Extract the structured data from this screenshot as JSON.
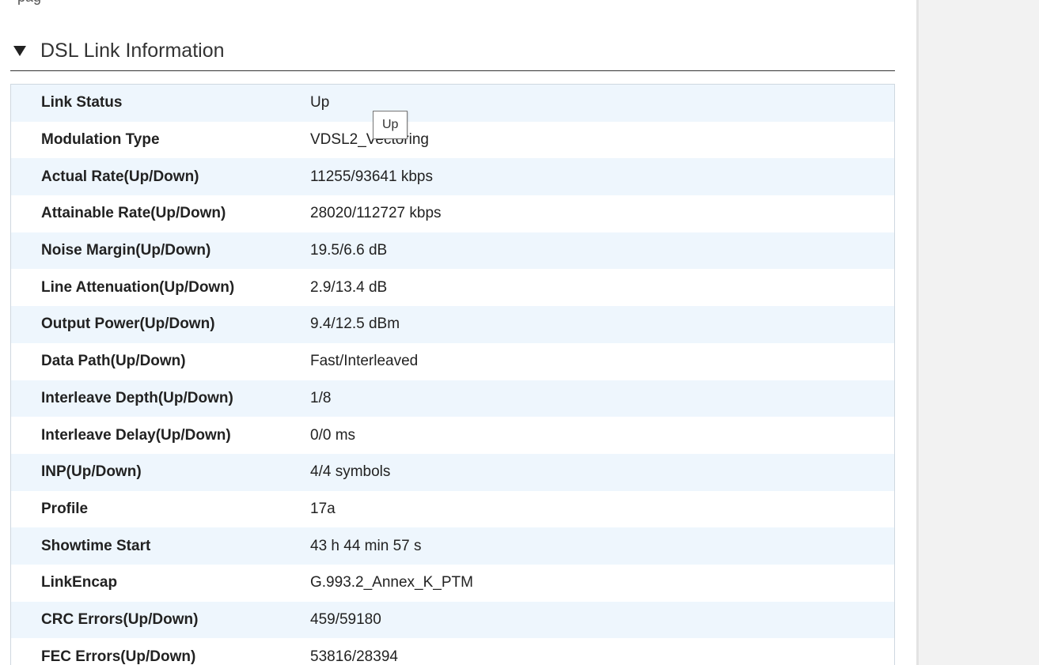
{
  "top_fragment": "pag",
  "section": {
    "title": "DSL Link Information"
  },
  "rows": [
    {
      "label": "Link Status",
      "value": "Up"
    },
    {
      "label": "Modulation Type",
      "value": "VDSL2_Vectoring"
    },
    {
      "label": "Actual Rate(Up/Down)",
      "value": "11255/93641 kbps"
    },
    {
      "label": "Attainable Rate(Up/Down)",
      "value": "28020/112727 kbps"
    },
    {
      "label": "Noise Margin(Up/Down)",
      "value": "19.5/6.6 dB"
    },
    {
      "label": "Line Attenuation(Up/Down)",
      "value": "2.9/13.4 dB"
    },
    {
      "label": "Output Power(Up/Down)",
      "value": "9.4/12.5 dBm"
    },
    {
      "label": "Data Path(Up/Down)",
      "value": "Fast/Interleaved"
    },
    {
      "label": "Interleave Depth(Up/Down)",
      "value": "1/8"
    },
    {
      "label": "Interleave Delay(Up/Down)",
      "value": "0/0 ms"
    },
    {
      "label": "INP(Up/Down)",
      "value": "4/4 symbols"
    },
    {
      "label": "Profile",
      "value": "17a"
    },
    {
      "label": "Showtime Start",
      "value": "43 h 44 min 57 s"
    },
    {
      "label": "LinkEncap",
      "value": "G.993.2_Annex_K_PTM"
    },
    {
      "label": "CRC Errors(Up/Down)",
      "value": "459/59180"
    },
    {
      "label": "FEC Errors(Up/Down)",
      "value": "53816/28394"
    }
  ],
  "tooltip": {
    "text": "Up"
  },
  "colors": {
    "row_alt_background": "#eef6fd",
    "side_panel": "#f2f2f2"
  }
}
